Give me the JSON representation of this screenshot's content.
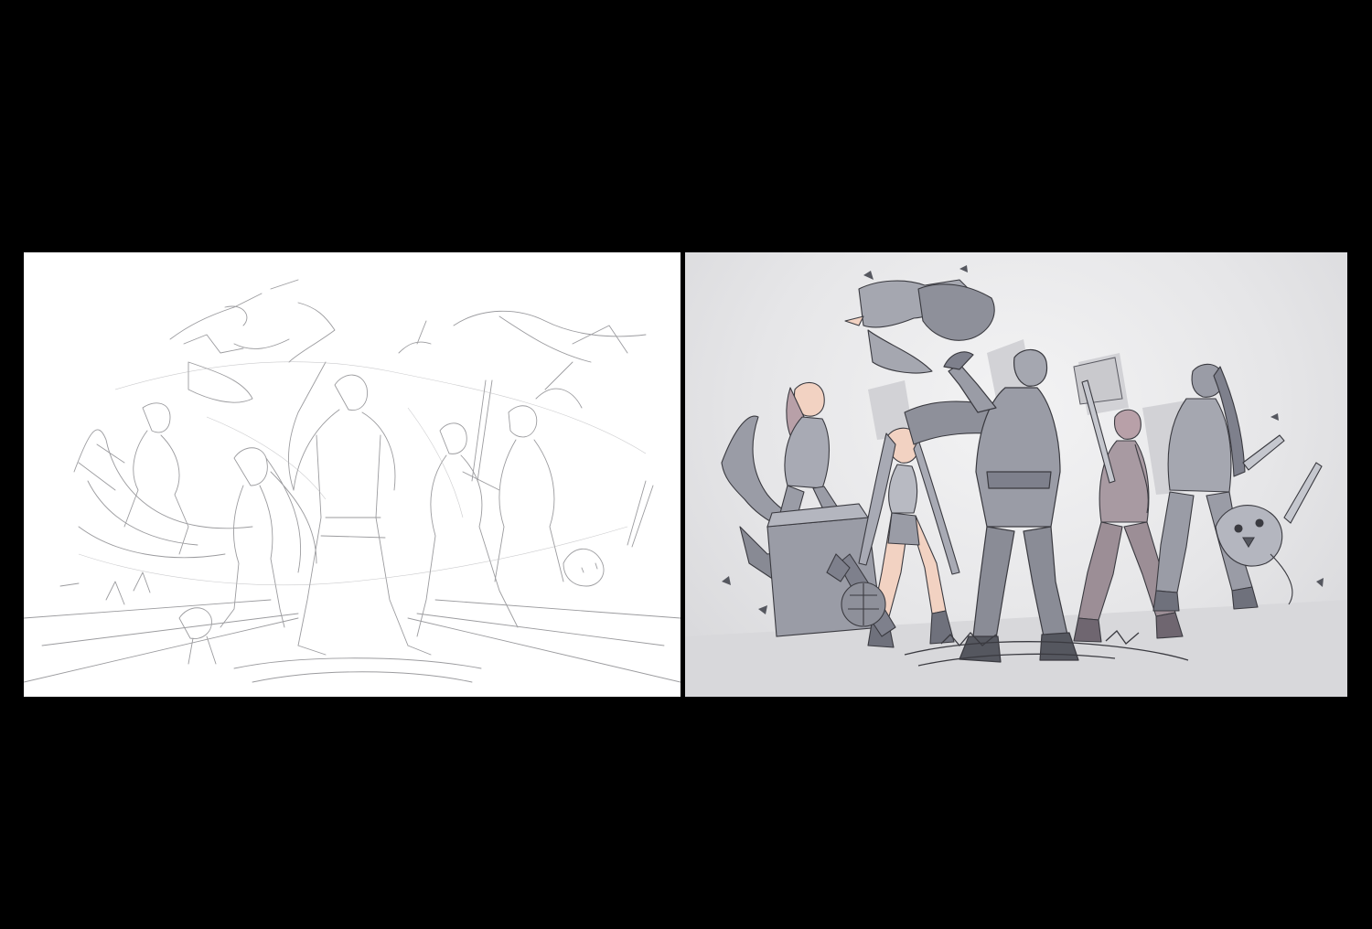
{
  "colors": {
    "background": "#000000",
    "sketch_paper": "#ffffff",
    "sketch_stroke": "#8a8a8e",
    "lineart_bg": "#e4e4e6",
    "lineart_stroke": "#3a3a40",
    "figure_fill": "#9a9ca6",
    "figure_fill_dark": "#7e808c",
    "figure_fill_warm": "#a89aa2",
    "skin_accent": "#f2d2c2"
  },
  "panels": [
    {
      "name": "pencil-sketch",
      "style": "rough sketch"
    },
    {
      "name": "grayscale-lineart",
      "style": "flat gray lineart"
    }
  ]
}
